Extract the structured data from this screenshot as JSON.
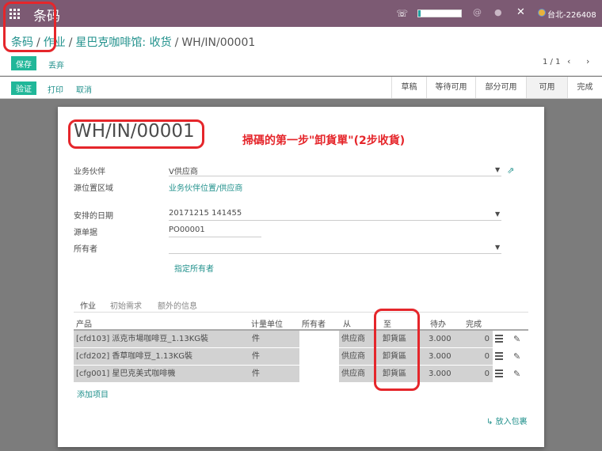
{
  "topbar": {
    "app_title": "条码",
    "user_name": "台北-226408",
    "progress_fraction": 0.05
  },
  "breadcrumb": {
    "items": [
      "条码",
      "作业",
      "星巴克咖啡馆: 收货"
    ],
    "current": "WH/IN/00001",
    "separator": "/"
  },
  "actions": {
    "save_label": "保存",
    "discard_label": "丢弃",
    "validate_label": "验证",
    "print_label": "打印",
    "cancel_label": "取消"
  },
  "pager": {
    "value": "1 / 1",
    "prev": "‹",
    "next": "›"
  },
  "status_stages": [
    "草稿",
    "等待可用",
    "部分可用",
    "可用",
    "完成"
  ],
  "active_stage": "可用",
  "document": {
    "name": "WH/IN/00001",
    "annotation": "掃碼的第一步\"卸貨單\"(2步收貨)"
  },
  "fields": {
    "partner_label": "业务伙伴",
    "partner_value": "V供应商",
    "source_location_label": "源位置区域",
    "source_location_value": "业务伙伴位置/供应商",
    "scheduled_date_label": "安排的日期",
    "scheduled_date_value": "20171215 141455",
    "source_doc_label": "源单据",
    "source_doc_value": "PO00001",
    "owner_label": "所有者",
    "owner_value": "",
    "assign_owner_label": "指定所有者"
  },
  "tabs": [
    "作业",
    "初始需求",
    "额外的信息"
  ],
  "table": {
    "headers": [
      "产品",
      "计量单位",
      "所有者",
      "从",
      "至",
      "待办",
      "完成"
    ],
    "rows": [
      {
        "product": "[cfd103] 派克市場咖啡豆_1.13KG裝",
        "uom": "件",
        "owner": "",
        "from": "供应商",
        "to": "卸貨區",
        "todo": "3.000",
        "done": "0"
      },
      {
        "product": "[cfd202] 香草咖啡豆_1.13KG裝",
        "uom": "件",
        "owner": "",
        "from": "供应商",
        "to": "卸貨區",
        "todo": "3.000",
        "done": "0"
      },
      {
        "product": "[cfg001] 星巴克美式咖啡機",
        "uom": "件",
        "owner": "",
        "from": "供应商",
        "to": "卸貨區",
        "todo": "3.000",
        "done": "0"
      }
    ],
    "add_item_label": "添加项目",
    "put_in_pack_label": "放入包裹"
  },
  "colors": {
    "topbar": "#7c5a73",
    "primary": "#21b799",
    "link": "#21918c",
    "annotation": "#e5262b"
  }
}
